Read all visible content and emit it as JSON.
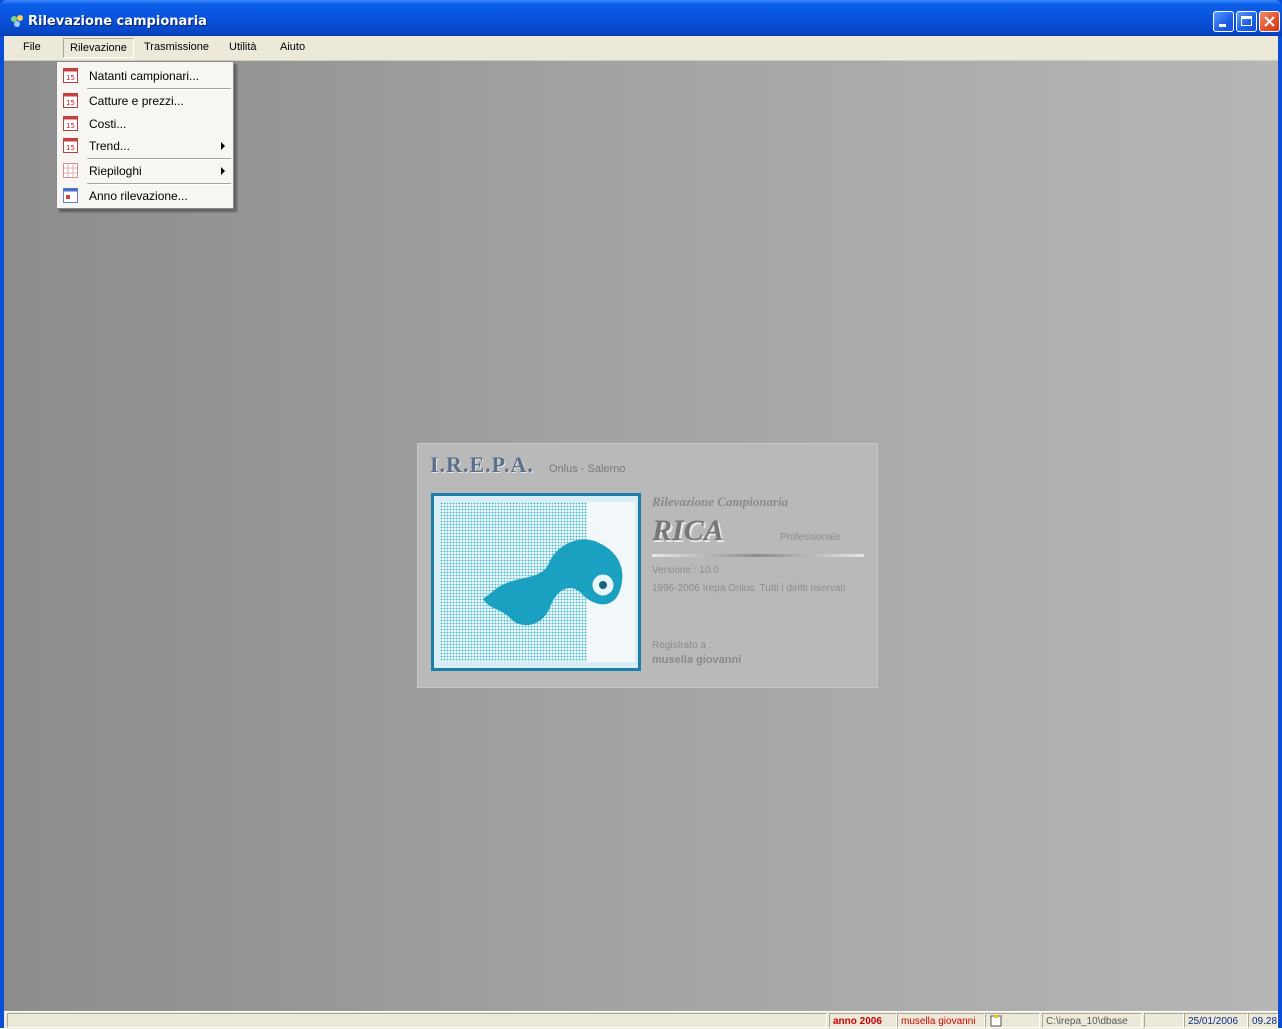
{
  "window": {
    "title": "Rilevazione campionaria"
  },
  "menubar": {
    "file": "File",
    "rilevazione": "Rilevazione",
    "trasmissione": "Trasmissione",
    "utilita": "Utilità",
    "aiuto": "Aiuto"
  },
  "dropdown": {
    "items": [
      {
        "label": "Natanti campionari...",
        "icon": "calendar-15-icon"
      },
      {
        "label": "Catture e prezzi...",
        "icon": "calendar-15-icon"
      },
      {
        "label": "Costi...",
        "icon": "calendar-15-icon"
      },
      {
        "label": "Trend...",
        "icon": "calendar-15-icon",
        "submenu": true
      },
      {
        "label": "Riepiloghi",
        "icon": "grid-icon",
        "submenu": true
      },
      {
        "label": "Anno rilevazione...",
        "icon": "form-icon"
      }
    ]
  },
  "splash": {
    "brand": "I.R.E.P.A.",
    "brand_sub": "Onlus - Salerno",
    "app_title": "Rilevazione Campionaria",
    "app_name": "RICA",
    "edition": "Professionale",
    "version": "Versione : 10.0",
    "copyright": "1996-2006 Irepa Onlus. Tutti i diritti riservati",
    "registered_label": "Registrato a :",
    "registered_user": "musella giovanni"
  },
  "statusbar": {
    "year": "anno  2006",
    "user": "musella giovanni",
    "path": "C:\\irepa_10\\dbase",
    "date": "25/01/2006",
    "time": "09.28"
  },
  "colors": {
    "title_bar": "#0a53dc",
    "year_text": "#cc0000",
    "logo_teal": "#1aa0c0"
  }
}
